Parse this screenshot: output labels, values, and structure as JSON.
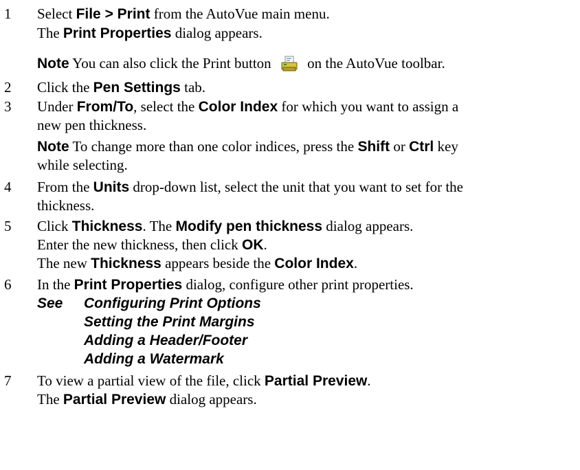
{
  "steps": [
    {
      "num": "1",
      "l1": {
        "a": "Select ",
        "b": "File > Print",
        "c": " from the AutoVue main menu."
      },
      "l2": {
        "a": "The ",
        "b": "Print Properties",
        "c": " dialog appears."
      },
      "note": {
        "label": "Note",
        "a": "  You can also click the Print button ",
        "b": " on the AutoVue toolbar."
      }
    },
    {
      "num": "2",
      "l1": {
        "a": "Click the ",
        "b": "Pen Settings",
        "c": " tab."
      }
    },
    {
      "num": "3",
      "l1": {
        "a": "Under ",
        "b": "From/To",
        "c": ", select the ",
        "d": "Color Index",
        "e": " for which you want to assign a"
      },
      "l2": "new pen thickness.",
      "note": {
        "label": "Note",
        "a": "  To change more than one color indices, press the ",
        "b": "Shift",
        "c": " or ",
        "d": "Ctrl",
        "e": " key"
      },
      "l3": "while selecting."
    },
    {
      "num": "4",
      "l1": {
        "a": "From the ",
        "b": "Units",
        "c": " drop-down list, select the unit that you want to set for the"
      },
      "l2": "thickness."
    },
    {
      "num": "5",
      "l1": {
        "a": "Click ",
        "b": "Thickness",
        "c": ". The ",
        "d": "Modify pen thickness",
        "e": " dialog appears."
      },
      "l2": {
        "a": "Enter the new thickness, then click ",
        "b": "OK",
        "c": "."
      },
      "l3": {
        "a": "The new ",
        "b": "Thickness",
        "c": " appears beside the ",
        "d": "Color Index",
        "e": "."
      }
    },
    {
      "num": "6",
      "l1": {
        "a": "In the ",
        "b": "Print Properties",
        "c": " dialog, configure other print properties."
      },
      "see": {
        "label": "See",
        "links": [
          "Configuring Print Options",
          "Setting the Print Margins",
          "Adding a Header/Footer",
          "Adding a Watermark"
        ]
      }
    },
    {
      "num": "7",
      "l1": {
        "a": "To view a partial view of the file, click ",
        "b": "Partial Preview",
        "c": "."
      },
      "l2": {
        "a": "The ",
        "b": "Partial Preview",
        "c": " dialog appears."
      }
    }
  ],
  "icons": {
    "print_button": "print-icon"
  },
  "colors": {
    "printer_body": "#d8c23a",
    "printer_paper": "#ffffff",
    "printer_dark": "#6b5d10"
  }
}
